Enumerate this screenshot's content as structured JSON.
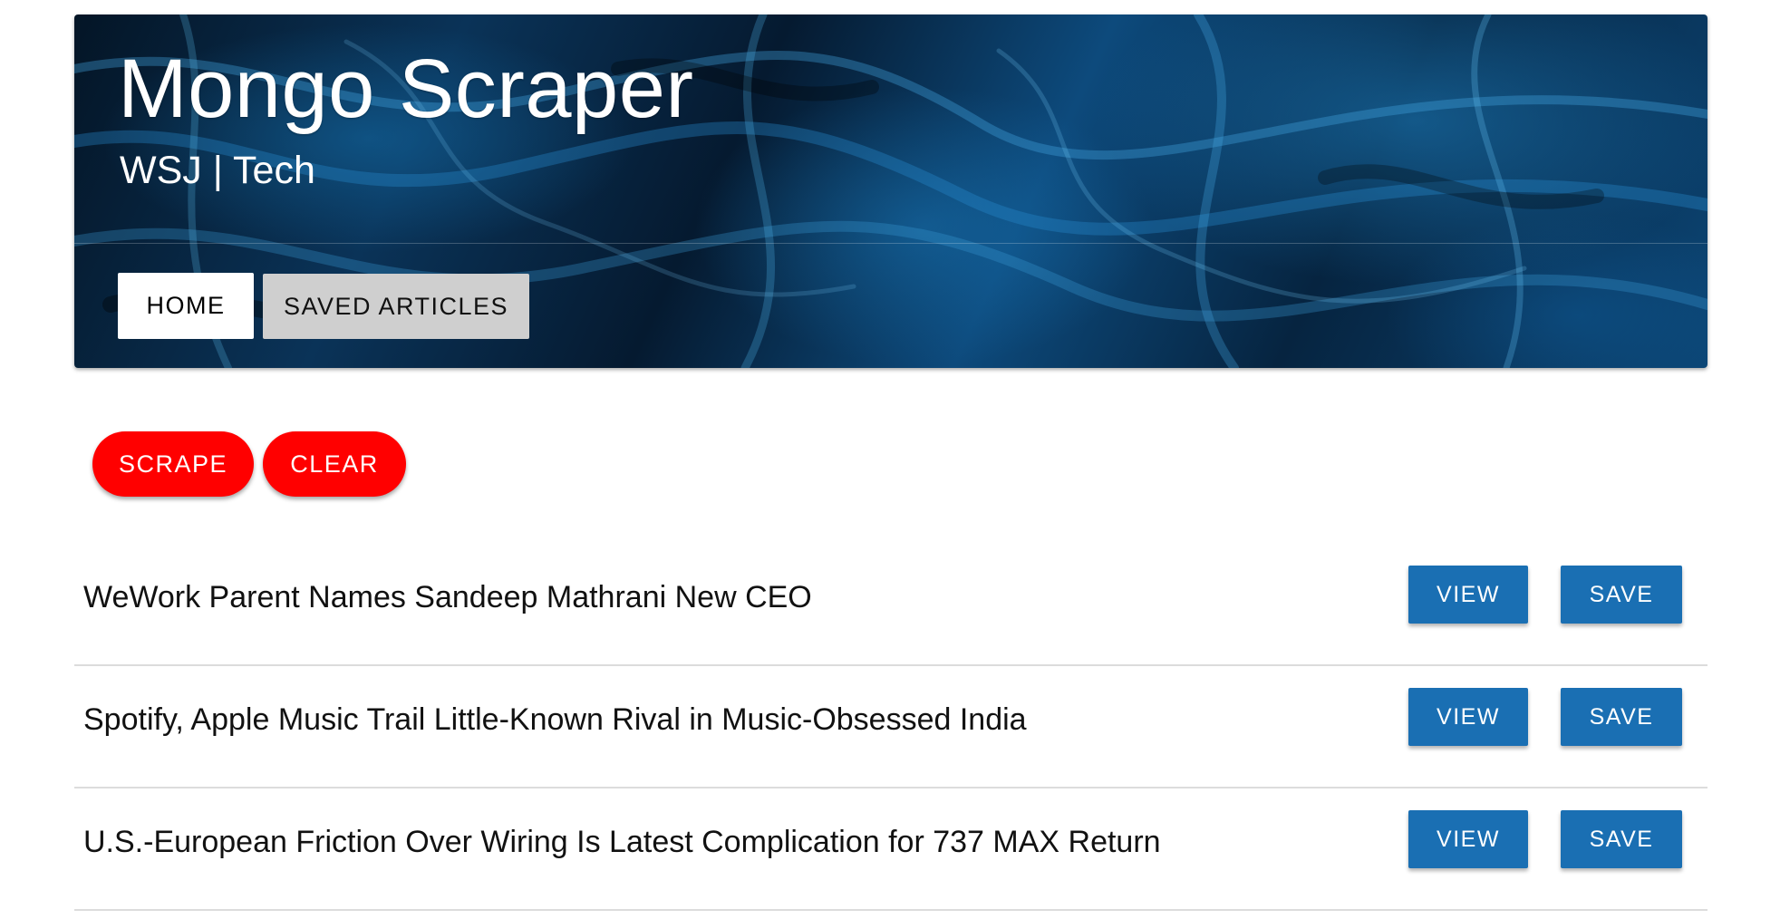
{
  "header": {
    "title": "Mongo Scraper",
    "subtitle": "WSJ | Tech",
    "nav": {
      "home_label": "HOME",
      "saved_label": "SAVED ARTICLES"
    }
  },
  "actions": {
    "scrape_label": "SCRAPE",
    "clear_label": "CLEAR"
  },
  "articles": [
    {
      "title": "WeWork Parent Names Sandeep Mathrani New CEO",
      "view_label": "VIEW",
      "save_label": "SAVE"
    },
    {
      "title": "Spotify, Apple Music Trail Little-Known Rival in Music-Obsessed India",
      "view_label": "VIEW",
      "save_label": "SAVE"
    },
    {
      "title": "U.S.-European Friction Over Wiring Is Latest Complication for 737 MAX Return",
      "view_label": "VIEW",
      "save_label": "SAVE"
    }
  ],
  "colors": {
    "accent_red": "#ff0000",
    "button_blue": "#1a6fb3",
    "header_dark_blue": "#0a3358"
  }
}
